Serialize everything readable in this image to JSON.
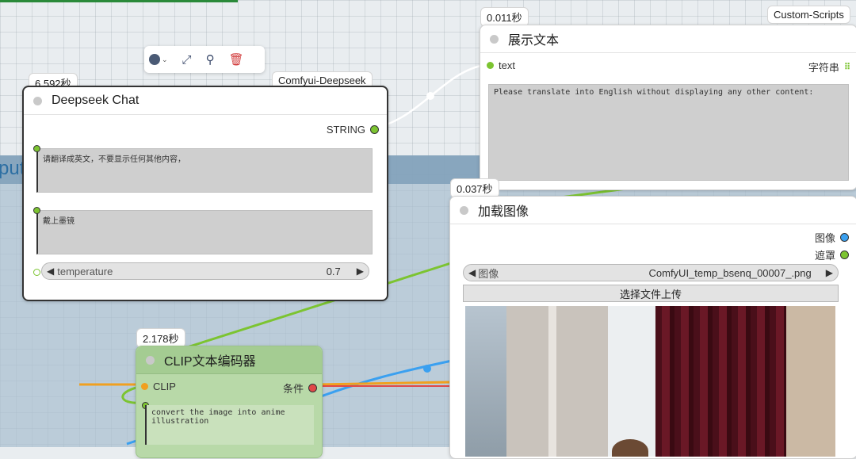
{
  "group": {
    "title": "put"
  },
  "toolbar": {
    "color_icon": "color-circle-icon",
    "bypass_icon": "bypass-icon",
    "pin_icon": "pin-icon",
    "delete_icon": "trash-icon"
  },
  "nodes": {
    "deepseek": {
      "badge": "6.592秒",
      "tag": "Comfyui-Deepseek",
      "title": "Deepseek Chat",
      "output_label": "STRING",
      "prompt_text": "请翻译成英文，不要显示任何其他内容，",
      "input_text": "戴上墨镜",
      "temperature_label": "temperature",
      "temperature_value": "0.7"
    },
    "show_text": {
      "badge": "0.011秒",
      "tag": "Custom-Scripts",
      "title": "展示文本",
      "input_label": "text",
      "output_label": "字符串",
      "content": "Please translate into English without displaying any other content:"
    },
    "load_image": {
      "badge": "0.037秒",
      "title": "加载图像",
      "output_image": "图像",
      "output_mask": "遮罩",
      "image_label": "图像",
      "image_value": "ComfyUI_temp_bsenq_00007_.png",
      "upload_label": "选择文件上传"
    },
    "clip": {
      "badge": "2.178秒",
      "title": "CLIP文本编码器",
      "input_label": "CLIP",
      "output_label": "条件",
      "text": "convert the image into anime illustration"
    }
  },
  "colors": {
    "string_port": "#7cc431",
    "image_port": "#3aa0f0",
    "mask_port": "#7cc431",
    "clip_port": "#f0a020",
    "cond_port": "#e04848"
  }
}
